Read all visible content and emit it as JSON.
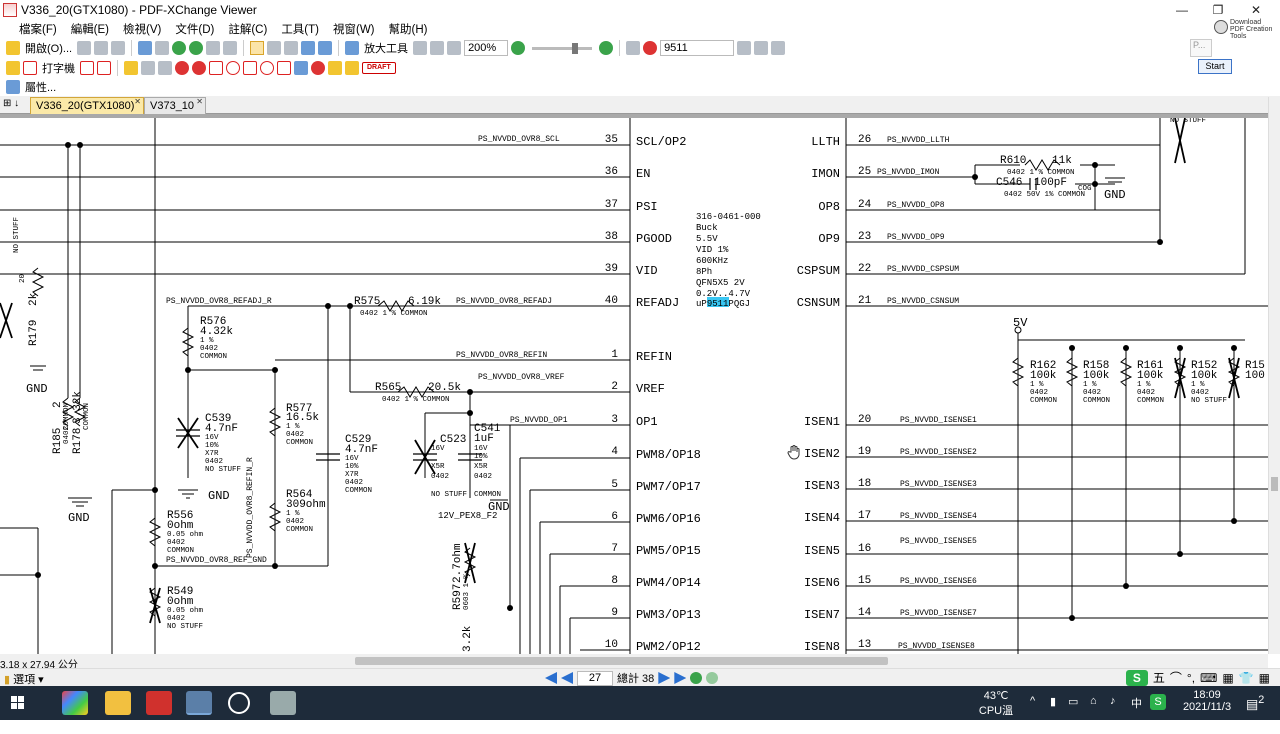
{
  "window": {
    "title": "V336_20(GTX1080) - PDF-XChange Viewer",
    "minimize": "—",
    "restore": "❐",
    "close": "✕"
  },
  "menu": [
    "檔案(F)",
    "編輯(E)",
    "檢視(V)",
    "文件(D)",
    "註解(C)",
    "工具(T)",
    "視窗(W)",
    "幫助(H)"
  ],
  "download_banner": "Download PDF Creation Tools",
  "toolbar1": {
    "open_label": "開啟(O)...",
    "zoom_tool": "放大工具",
    "zoom_value": "200%",
    "search_value": "9511"
  },
  "toolbar2": {
    "typewriter": "打字機",
    "draft_stamp": "DRAFT"
  },
  "toolbar3": {
    "properties": "屬性..."
  },
  "popup": {
    "field_text": "P...",
    "start_button": "Start"
  },
  "tabs": [
    {
      "label": "V336_20(GTX1080)",
      "active": true
    },
    {
      "label": "V373_10",
      "active": false
    }
  ],
  "schematic": {
    "chip": {
      "info_lines": [
        "316-0461-000",
        "Buck",
        "5.5V",
        "VID   1%",
        "600KHz",
        "  8Ph",
        "QFN5X5    2V",
        "0.2V..4.7V"
      ],
      "part_prefix": "uP",
      "part_highlight": "9511",
      "part_suffix": "PQGJ",
      "left_pins": [
        {
          "num": "35",
          "name": "SCL/OP2"
        },
        {
          "num": "36",
          "name": "EN"
        },
        {
          "num": "37",
          "name": "PSI"
        },
        {
          "num": "38",
          "name": "PGOOD"
        },
        {
          "num": "39",
          "name": "VID"
        },
        {
          "num": "40",
          "name": "REFADJ"
        },
        {
          "num": "1",
          "name": "REFIN"
        },
        {
          "num": "2",
          "name": "VREF"
        },
        {
          "num": "3",
          "name": "OP1"
        },
        {
          "num": "4",
          "name": "PWM8/OP18"
        },
        {
          "num": "5",
          "name": "PWM7/OP17"
        },
        {
          "num": "6",
          "name": "PWM6/OP16"
        },
        {
          "num": "7",
          "name": "PWM5/OP15"
        },
        {
          "num": "8",
          "name": "PWM4/OP14"
        },
        {
          "num": "9",
          "name": "PWM3/OP13"
        },
        {
          "num": "10",
          "name": "PWM2/OP12"
        }
      ],
      "right_pins": [
        {
          "num": "26",
          "name": "LLTH"
        },
        {
          "num": "25",
          "name": "IMON"
        },
        {
          "num": "24",
          "name": "OP8"
        },
        {
          "num": "23",
          "name": "OP9"
        },
        {
          "num": "22",
          "name": "CSPSUM"
        },
        {
          "num": "21",
          "name": "CSNSUM"
        },
        {
          "num": "20",
          "name": "ISEN1"
        },
        {
          "num": "19",
          "name": "ISEN2"
        },
        {
          "num": "18",
          "name": "ISEN3"
        },
        {
          "num": "17",
          "name": "ISEN4"
        },
        {
          "num": "16",
          "name": "ISEN5"
        },
        {
          "num": "15",
          "name": "ISEN6"
        },
        {
          "num": "14",
          "name": "ISEN7"
        },
        {
          "num": "13",
          "name": "ISEN8"
        }
      ]
    },
    "nets_left": [
      "PS_NVVDD_OVR8_SCL",
      "PS_NVVDD_OVR8_REFADJ_R",
      "PS_NVVDD_OVR8_REFADJ",
      "PS_NVVDD_OVR8_REFIN",
      "PS_NVVDD_OVR8_VREF",
      "PS_NVVDD_OP1",
      "PS_NVVDD_OVR8_REF_GND",
      "PS_NVVDD_OVR8_REFIN_R"
    ],
    "nets_right": [
      "PS_NVVDD_LLTH",
      "PS_NVVDD_IMON",
      "PS_NVVDD_OP8",
      "PS_NVVDD_OP9",
      "PS_NVVDD_CSPSUM",
      "PS_NVVDD_CSNSUM",
      "PS_NVVDD_ISENSE1",
      "PS_NVVDD_ISENSE2",
      "PS_NVVDD_ISENSE3",
      "PS_NVVDD_ISENSE4",
      "PS_NVVDD_ISENSE5",
      "PS_NVVDD_ISENSE6",
      "PS_NVVDD_ISENSE7",
      "PS_NVVDD_ISENSE8"
    ],
    "components": {
      "r575": {
        "ref": "R575",
        "val": "6.19k",
        "sub": "0402  1 %  COMMON"
      },
      "r576": {
        "ref": "R576",
        "val": "4.32k",
        "sub": [
          "1 %",
          "0402",
          "COMMON"
        ]
      },
      "r577": {
        "ref": "R577",
        "val": "16.5k",
        "sub": [
          "1 %",
          "0402",
          "COMMON"
        ]
      },
      "r565": {
        "ref": "R565",
        "val": "20.5k",
        "sub": "0402  1 %  COMMON"
      },
      "r564": {
        "ref": "R564",
        "val": "309ohm",
        "sub": [
          "1 %",
          "0402",
          "COMMON"
        ]
      },
      "r556": {
        "ref": "R556",
        "val": "0ohm",
        "sub": [
          "0.05 ohm",
          "0402",
          "COMMON"
        ]
      },
      "r549": {
        "ref": "R549",
        "val": "0ohm",
        "sub": [
          "0.05 ohm",
          "0402",
          "NO STUFF"
        ]
      },
      "c539": {
        "ref": "C539",
        "val": "4.7nF",
        "sub": [
          "16V",
          "10%",
          "X7R",
          "0402",
          "NO STUFF"
        ]
      },
      "c529": {
        "ref": "C529",
        "val": "4.7nF",
        "sub": [
          "16V",
          "10%",
          "X7R",
          "0402",
          "COMMON"
        ]
      },
      "c523": {
        "ref": "C523",
        "val": "1uF",
        "sub": [
          "16V",
          "10%",
          "X5R",
          "0402",
          "NO STUFF"
        ]
      },
      "c541": {
        "ref": "C541",
        "val": "1uF",
        "sub": [
          "16V",
          "10%",
          "X5R",
          "0402",
          "COMMON"
        ]
      },
      "r610": {
        "ref": "R610",
        "val": "11k",
        "sub": "0402  1 %  COMMON"
      },
      "c546": {
        "ref": "C546",
        "val": "100pF",
        "sub": "0402  50V  1%  COMMON",
        "sub2": "COG"
      },
      "r162": {
        "ref": "R162",
        "val": "100k",
        "sub": [
          "1 %",
          "0402",
          "COMMON"
        ]
      },
      "r158": {
        "ref": "R158",
        "val": "100k",
        "sub": [
          "1 %",
          "0402",
          "COMMON"
        ]
      },
      "r161": {
        "ref": "R161",
        "val": "100k",
        "sub": [
          "1 %",
          "0402",
          "COMMON"
        ]
      },
      "r152": {
        "ref": "R152",
        "val": "100k",
        "sub": [
          "1 %",
          "0402",
          "NO STUFF"
        ]
      },
      "r15x": {
        "ref": "R15",
        "val": "100"
      },
      "r185": {
        "ref": "R185",
        "val": "2"
      },
      "r178": {
        "ref": "R178",
        "val": "3.32k"
      },
      "r179": {
        "ref": "R179",
        "val": "2k"
      },
      "r597": {
        "ref": "R597",
        "val": "2.7ohm",
        "sub": "0603  1 %"
      },
      "r_left_extra": {
        "ref": "R",
        "val": "3.2k"
      }
    },
    "power": {
      "five_v": "5V",
      "gnd": "GND",
      "rail_12v": "12V_PEX8_F2"
    },
    "misc": {
      "no_stuff": "NO STUFF",
      "common": "COMMON",
      "twenty_ohm": "20",
      "four_o_two": "0402"
    }
  },
  "status": {
    "coords": "3.18 x 27.94 公分",
    "options": "選項",
    "page_current": "27",
    "page_total": "總計 38",
    "ime": [
      "五",
      "⌒",
      "°,",
      "⌨",
      "▦",
      "👕",
      "▦"
    ]
  },
  "taskbar": {
    "temp": "43℃",
    "temp_label": "CPU溫度",
    "lang": "中",
    "time": "18:09",
    "date": "2021/11/3",
    "notif_count": "2"
  }
}
